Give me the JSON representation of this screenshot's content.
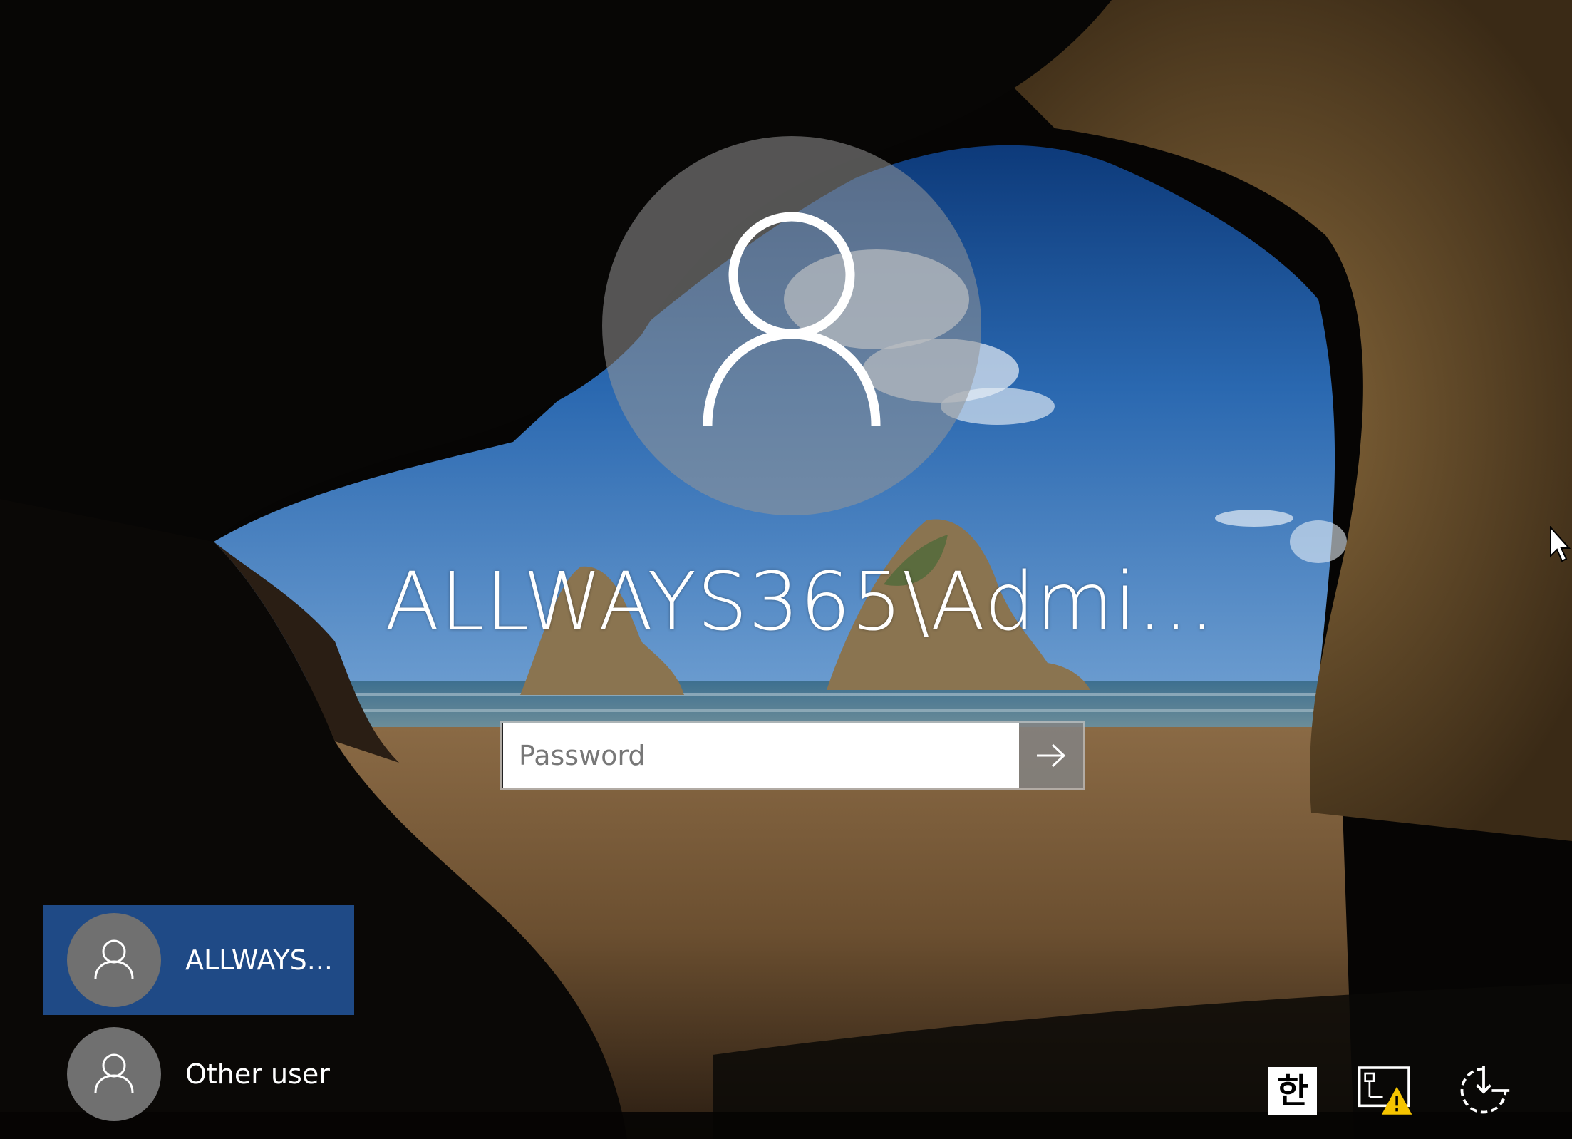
{
  "login": {
    "username_display": "ALLWAYS365\\Admi...",
    "password_placeholder": "Password",
    "password_value": ""
  },
  "user_list": [
    {
      "label": "ALLWAYS...",
      "selected": true
    },
    {
      "label": "Other user",
      "selected": false
    }
  ],
  "tray": {
    "ime_label": "한",
    "network_status": "warning",
    "icons": [
      "input-method-icon",
      "network-warning-icon",
      "power-icon"
    ]
  },
  "colors": {
    "selected_user_bg": "#1f4a86",
    "avatar_small_bg": "#707070",
    "warning": "#f5c400"
  }
}
